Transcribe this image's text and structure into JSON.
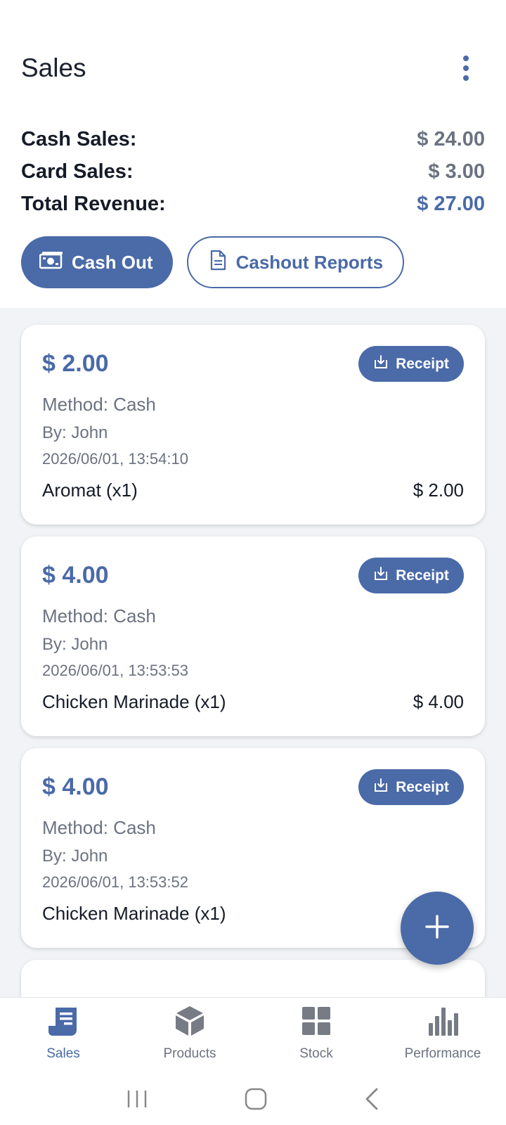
{
  "header": {
    "title": "Sales"
  },
  "summary": {
    "cash_label": "Cash Sales:",
    "cash_value": "$ 24.00",
    "card_label": "Card Sales:",
    "card_value": "$ 3.00",
    "total_label": "Total Revenue:",
    "total_value": "$ 27.00"
  },
  "actions": {
    "cash_out": "Cash Out",
    "cashout_reports": "Cashout Reports"
  },
  "sales": [
    {
      "amount": "$ 2.00",
      "receipt": "Receipt",
      "method": "Method: Cash",
      "by": "By: John",
      "timestamp": "2026/06/01, 13:54:10",
      "item": "Aromat (x1)",
      "item_price": "$ 2.00"
    },
    {
      "amount": "$ 4.00",
      "receipt": "Receipt",
      "method": "Method: Cash",
      "by": "By: John",
      "timestamp": "2026/06/01, 13:53:53",
      "item": "Chicken Marinade (x1)",
      "item_price": "$ 4.00"
    },
    {
      "amount": "$ 4.00",
      "receipt": "Receipt",
      "method": "Method: Cash",
      "by": "By: John",
      "timestamp": "2026/06/01, 13:53:52",
      "item": "Chicken Marinade (x1)",
      "item_price": ""
    }
  ],
  "bottom_nav": [
    {
      "label": "Sales",
      "icon": "receipt-icon",
      "active": true
    },
    {
      "label": "Products",
      "icon": "box-icon",
      "active": false
    },
    {
      "label": "Stock",
      "icon": "grid-icon",
      "active": false
    },
    {
      "label": "Performance",
      "icon": "bar-chart-icon",
      "active": false
    }
  ],
  "colors": {
    "accent": "#4a6aa8",
    "muted_text": "#6b7280",
    "list_bg": "#f1f3f6"
  }
}
